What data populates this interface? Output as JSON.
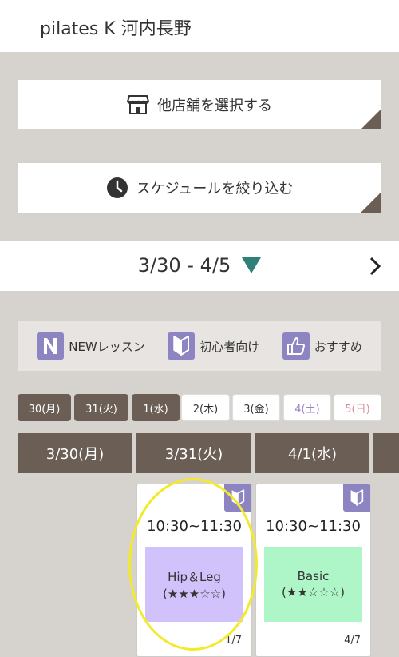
{
  "header": {
    "title": "pilates K 河内長野"
  },
  "buttons": {
    "store": {
      "label": "他店舗を選択する",
      "icon": "store-icon"
    },
    "filter": {
      "label": "スケジュールを絞り込む",
      "icon": "clock-icon"
    }
  },
  "week": {
    "range": "3/30 - 4/5",
    "dropdown_icon": "triangle-down-icon",
    "next_icon": "chevron-right-icon"
  },
  "legend": [
    {
      "label": "NEWレッスン",
      "icon": "new-badge-icon"
    },
    {
      "label": "初心者向け",
      "icon": "beginner-mark-icon"
    },
    {
      "label": "おすすめ",
      "icon": "thumbs-up-icon"
    }
  ],
  "day_tabs": [
    {
      "label": "30(月)",
      "state": "past"
    },
    {
      "label": "31(火)",
      "state": "past"
    },
    {
      "label": "1(水)",
      "state": "past"
    },
    {
      "label": "2(木)",
      "state": "future"
    },
    {
      "label": "3(金)",
      "state": "future"
    },
    {
      "label": "4(土)",
      "state": "sat"
    },
    {
      "label": "5(日)",
      "state": "sun"
    }
  ],
  "columns": [
    "3/30(月)",
    "3/31(火)",
    "4/1(水)"
  ],
  "lessons": [
    {
      "time": "10:30~11:30",
      "name": "Hip＆Leg",
      "rating": "(★★★☆☆)",
      "capacity": "1/7",
      "color": "#d1c2fb"
    },
    {
      "time": "10:30~11:30",
      "name": "Basic",
      "rating": "(★★☆☆☆)",
      "capacity": "4/7",
      "color": "#aef5c8"
    }
  ],
  "colors": {
    "accent": "#6b5e55",
    "badge": "#8d84c2",
    "highlight": "#f2ea2a",
    "teal": "#2f8076"
  }
}
